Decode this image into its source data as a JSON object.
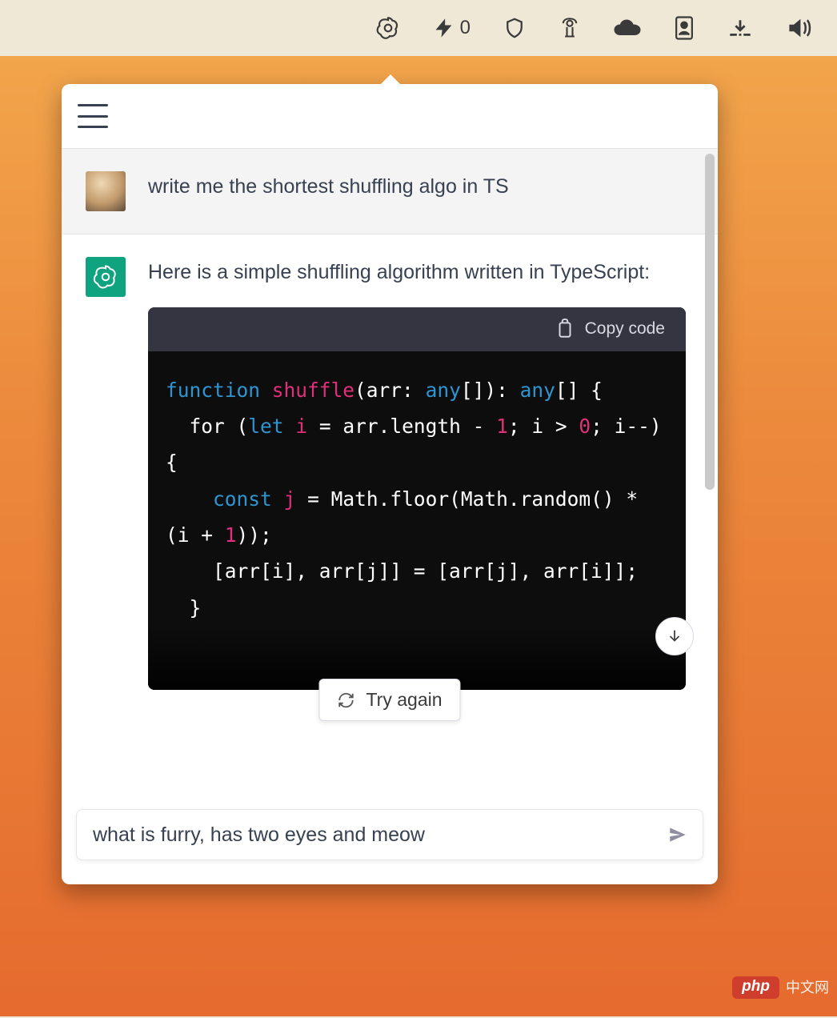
{
  "menubar": {
    "count_value": "0",
    "icons": [
      "openai-icon",
      "bolt-icon",
      "shield-icon",
      "tower-icon",
      "cloud-icon",
      "badge-icon",
      "download-icon",
      "volume-icon"
    ]
  },
  "chat": {
    "user_message": "write me the shortest shuffling algo in TS",
    "assistant_intro": "Here is a simple shuffling algorithm written in TypeScript:",
    "copy_label": "Copy code",
    "code": {
      "kw_function": "function",
      "fn_name": "shuffle",
      "sig_open": "(arr: ",
      "ty_any1": "any",
      "sig_arr1": "[]): ",
      "ty_any2": "any",
      "sig_arr2": "[] {",
      "line2_for": "  for (",
      "kw_let": "let",
      "sp_i": " ",
      "id_i": "i",
      "line2_mid": " = arr.length - ",
      "num_1a": "1",
      "line2_end": "; i > ",
      "num_0": "0",
      "line3_end": "; i--) {",
      "line4_const": "    ",
      "kw_const": "const",
      "sp_j": " ",
      "id_j": "j",
      "line4_eq": " = ",
      "line5_math": "Math.floor(Math.random() * (i + ",
      "num_1b": "1",
      "line5_end": "));",
      "line6_a": "    [arr[i], arr[j]] = [arr[j], arr[i]];",
      "line_close1": "  }"
    }
  },
  "controls": {
    "try_again_label": "Try again"
  },
  "input": {
    "value": "what is furry, has two eyes and meow",
    "placeholder": ""
  },
  "watermark": {
    "brand": "php",
    "text": "中文网"
  }
}
